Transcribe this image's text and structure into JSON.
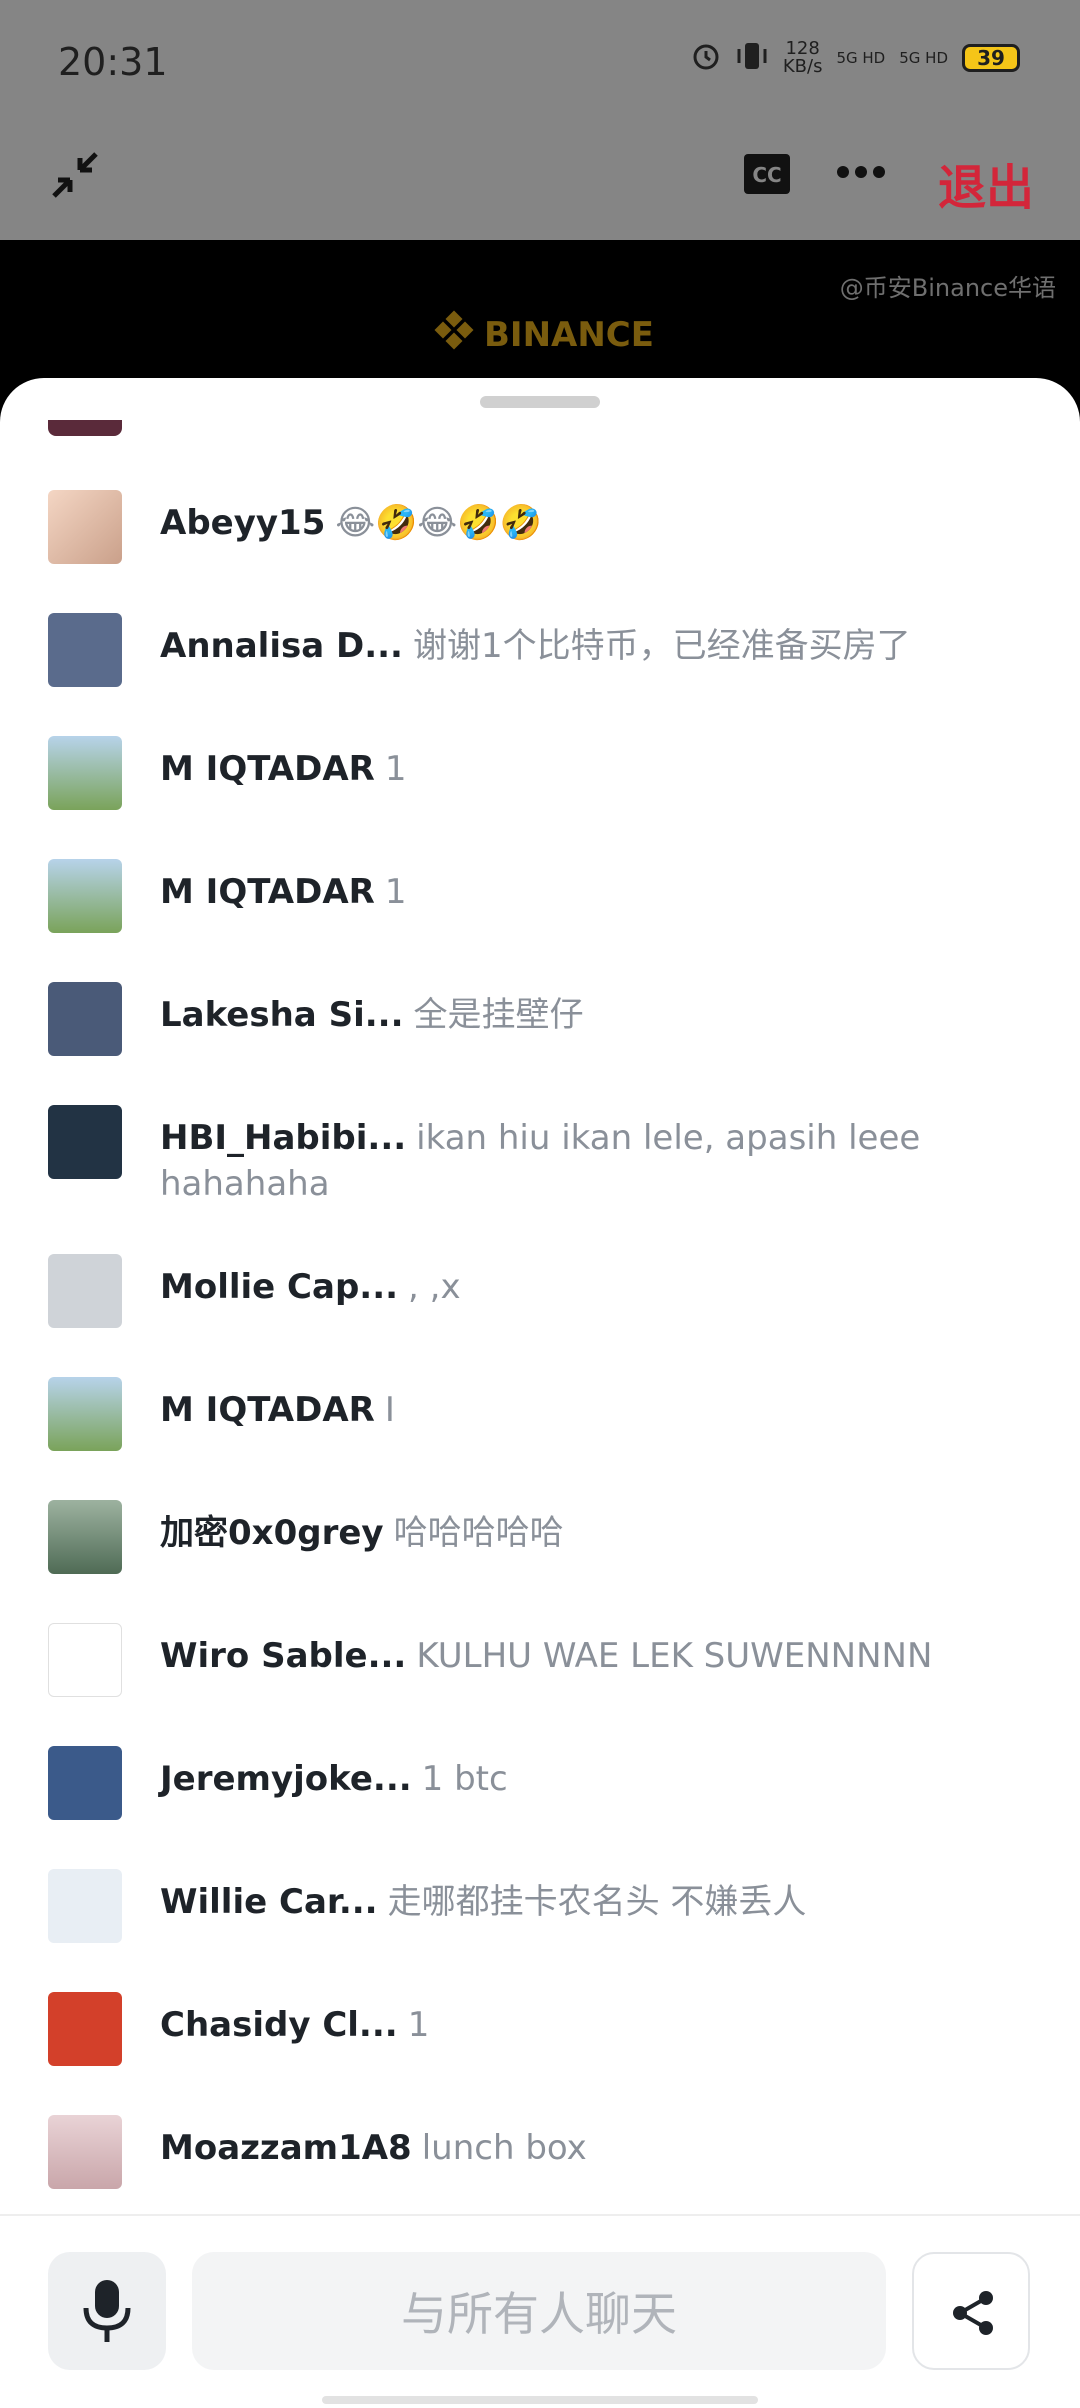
{
  "status": {
    "time": "20:31",
    "speed_value": "128",
    "speed_unit": "KB/s",
    "net1": "5G HD",
    "net2": "5G HD",
    "battery": "39"
  },
  "toolbar": {
    "exit_label": "退出"
  },
  "video": {
    "watermark": "@币安Binance华语",
    "logo_text": "BINANCE"
  },
  "colors": {
    "exit": "#d3263a",
    "username": "#1e2329",
    "message": "#8a9099",
    "binance_gold": "#f0b90b"
  },
  "chat": [
    {
      "name": "Abeyy15",
      "text": "😂🤣😂🤣🤣"
    },
    {
      "name": "Annalisa D...",
      "text": "谢谢1个比特币，已经准备买房了"
    },
    {
      "name": "M IQTADAR",
      "text": "1"
    },
    {
      "name": "M IQTADAR",
      "text": "1"
    },
    {
      "name": "Lakesha Si...",
      "text": "全是挂壁仔"
    },
    {
      "name": "HBI_Habibi...",
      "text": "ikan hiu ikan lele, apasih leee hahahaha"
    },
    {
      "name": "Mollie Cap...",
      "text": ", ,x"
    },
    {
      "name": "M IQTADAR",
      "text": "I"
    },
    {
      "name": "加密0x0grey",
      "text": "哈哈哈哈哈"
    },
    {
      "name": "Wiro Sable...",
      "text": "KULHU WAE LEK SUWENNNNN"
    },
    {
      "name": "Jeremyjoke...",
      "text": "1 btc"
    },
    {
      "name": "Willie Car...",
      "text": "走哪都挂卡农名头 不嫌丢人"
    },
    {
      "name": "Chasidy Cl...",
      "text": "1"
    },
    {
      "name": "Moazzam1A8",
      "text": "lunch box"
    }
  ],
  "input": {
    "placeholder": "与所有人聊天"
  }
}
